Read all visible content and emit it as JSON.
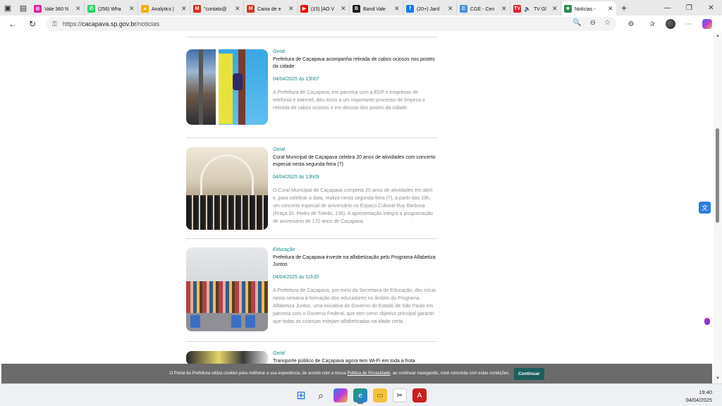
{
  "browser": {
    "tabs": [
      {
        "title": "Vale 360 N",
        "color": "#d6249f",
        "glyph": "◎"
      },
      {
        "title": "(256) Wha",
        "color": "#25d366",
        "glyph": "✆"
      },
      {
        "title": "Analytics |",
        "color": "#f9ab00",
        "glyph": "▲"
      },
      {
        "title": "\"contato@",
        "color": "#d93025",
        "glyph": "M"
      },
      {
        "title": "Caixa de e",
        "color": "#d93025",
        "glyph": "M"
      },
      {
        "title": "(15) [AO V",
        "color": "#ff0000",
        "glyph": "▶"
      },
      {
        "title": "Band Vale",
        "color": "#1b1b1b",
        "glyph": "B"
      },
      {
        "title": "(20+) Jard",
        "color": "#1877f2",
        "glyph": "f"
      },
      {
        "title": "CGE - Cen",
        "color": "#4a90d9",
        "glyph": "C"
      },
      {
        "title": "TV Gl",
        "color": "#e0242b",
        "glyph": "TV"
      },
      {
        "title": "Notícias -",
        "color": "#2e8b57",
        "glyph": "★"
      }
    ],
    "url": {
      "scheme": "https://",
      "host": "cacapava.sp.gov.br",
      "path": "/noticias"
    }
  },
  "news": [
    {
      "category": "Geral",
      "title": "Prefeitura de Caçapava acompanha retirada de cabos ociosos nos postes da cidade",
      "date": "04/04/2025 às 15h07",
      "description": "A Prefeitura de Caçapava, em parceria com a EDP e empresas de telefonia e internet, deu início a um importante processo de limpeza e retirada de cabos ociosos e em desuso dos postes da cidade."
    },
    {
      "category": "Geral",
      "title": "Coral Municipal de Caçapava celebra 20 anos de atividades com concerto especial nesta segunda-feira (7)",
      "date": "04/04/2025 às 13h09",
      "description": "O Coral Municipal de Caçapava completa 20 anos de atividades em abril e, para celebrar a data, realiza nesta segunda-feira (7), a partir das 19h, um concerto especial de aniversário no Espaço Cultural Ruy Barbosa (Praça Dr. Pedro de Toledo, 136). A apresentação integra a programação de aniversário de 170 anos de Caçapava."
    },
    {
      "category": "Educação",
      "title": "Prefeitura de Caçapava investe na alfabetização pelo Programa Alfabetiza Juntos",
      "date": "04/04/2025 às 11h35",
      "description": "A Prefeitura de Caçapava, por meio da Secretaria de Educação, deu início nesta semana à formação dos educadores no âmbito do Programa Alfabetiza Juntos, uma iniciativa do Governo do Estado de São Paulo em parceria com o Governo Federal, que tem como objetivo principal garantir que todas as crianças estejam alfabetizadas na idade certa."
    },
    {
      "category": "Geral",
      "title": "Transporte público de Caçapava agora tem Wi-Fi em toda a frota",
      "date": "",
      "description": ""
    }
  ],
  "cookie": {
    "text_before": "O Portal da Prefeitura utiliza cookies para melhorar a sua experiência, de acordo com a nossa",
    "link": "Política de Privacidade",
    "text_after": ", ao continuar navegando, você concorda com estas condições.",
    "button": "Continuar"
  },
  "taskbar": {
    "time": "19:40",
    "date": "04/04/2025"
  }
}
